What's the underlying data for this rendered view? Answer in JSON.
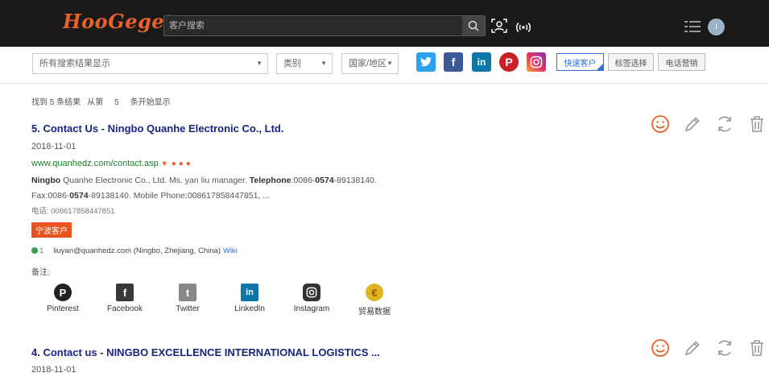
{
  "header": {
    "logo": "HooGege",
    "logo_mark": "®",
    "search_placeholder": "客户搜索",
    "avatar_letter": "I"
  },
  "filters": {
    "all_select": "所有搜索结果显示",
    "type_select": "类别",
    "country_select": "国家/地区",
    "buttons": [
      "快速客户",
      "标签选择",
      "电话营销"
    ]
  },
  "social_filter": [
    "twitter",
    "facebook",
    "linkedin",
    "pinterest",
    "instagram"
  ],
  "summary": {
    "found": "找到 5 条结果",
    "from": "从第",
    "num": "5",
    "rest": "条开始显示"
  },
  "results": [
    {
      "title": "5. Contact Us - Ningbo Quanhe Electronic Co., Ltd.",
      "date": "2018-11-01",
      "url": "www.quanhedz.com/contact.asp",
      "snippet_pre": "Ningbo",
      "snippet_1": " Quanhe Electronic Co., Ltd. Ms. yan liu manager. ",
      "snippet_tel": "Telephone",
      "snippet_2": ":0086-",
      "snippet_code": "0574",
      "snippet_3": "-89138140. Fax:0086-",
      "snippet_code2": "0574",
      "snippet_4": "-89138140. Mobile Phone:008617858447851, ...",
      "phone": "电话: 008617858447851",
      "tag": "宁波客户",
      "email_count": "1",
      "email": "liuyan@quanhedz.com (Ningbo, Zhejiang, China)",
      "wiki": "Wiki",
      "note": "备注:"
    },
    {
      "title": "4. Contact us - NINGBO EXCELLENCE INTERNATIONAL LOGISTICS ...",
      "date": "2018-11-01"
    }
  ],
  "social_links": [
    {
      "label": "Pinterest",
      "icon": "pinterest-icon"
    },
    {
      "label": "Facebook",
      "icon": "facebook-icon"
    },
    {
      "label": "Twitter",
      "icon": "twitter-icon"
    },
    {
      "label": "LinkedIn",
      "icon": "linkedin-icon"
    },
    {
      "label": "Instagram",
      "icon": "instagram-icon"
    },
    {
      "label": "贸易数据",
      "icon": "trade-data-icon"
    }
  ],
  "colors": {
    "accent": "#e8622c",
    "title_blue": "#1a237e",
    "url_green": "#19822a",
    "link_blue": "#2e6fd8"
  }
}
